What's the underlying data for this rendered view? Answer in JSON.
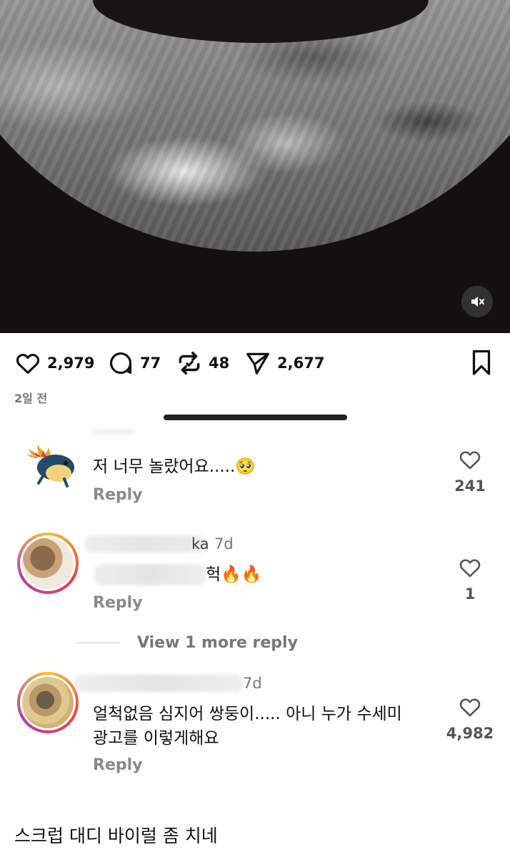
{
  "post": {
    "likes": "2,979",
    "comments": "77",
    "reposts": "48",
    "shares": "2,677",
    "timestamp": "2일 전"
  },
  "comments": [
    {
      "text": "저 너무 놀랐어요.....🥺",
      "reply_label": "Reply",
      "like_count": "241",
      "avatar_icon": "fire-creature-avatar"
    },
    {
      "username_fragment": "ka",
      "time": "7d",
      "text_visible_tail": "헉🔥🔥",
      "reply_label": "Reply",
      "like_count": "1",
      "avatar_icon": "chipmunk-avatar"
    },
    {
      "view_more_label": "View 1 more reply"
    },
    {
      "time": "7d",
      "text_line1": "얼척없음 심지어 쌍둥이..... 아니 누가 수세미",
      "text_line2": "광고를 이렇게해요",
      "reply_label": "Reply",
      "like_count": "4,982",
      "avatar_icon": "cat-avatar"
    }
  ],
  "caption": "스크럽 대디 바이럴 좀 치네",
  "colors": {
    "accent_text": "#111111",
    "muted_text": "#8a8a8a",
    "ring_gradient": [
      "#f6c12a",
      "#e8404a",
      "#b83ab0"
    ]
  }
}
